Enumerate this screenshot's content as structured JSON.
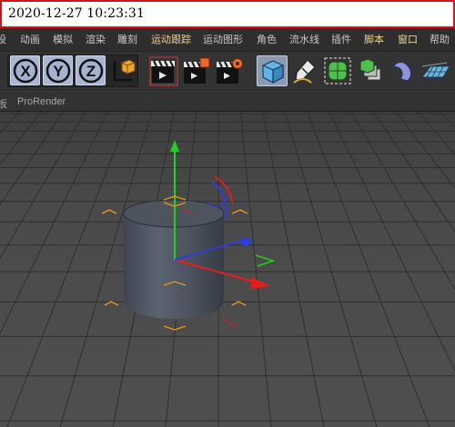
{
  "timestamp": "2020-12-27  10:23:31",
  "menu": {
    "items": [
      {
        "label": "设",
        "highlight": false
      },
      {
        "label": "动画",
        "highlight": false
      },
      {
        "label": "模拟",
        "highlight": false
      },
      {
        "label": "渲染",
        "highlight": false
      },
      {
        "label": "雕刻",
        "highlight": false
      },
      {
        "label": "运动跟踪",
        "highlight": true
      },
      {
        "label": "运动图形",
        "highlight": false
      },
      {
        "label": "角色",
        "highlight": false
      },
      {
        "label": "流水线",
        "highlight": false
      },
      {
        "label": "插件",
        "highlight": false
      },
      {
        "label": "脚本",
        "highlight": true
      },
      {
        "label": "窗口",
        "highlight": true
      },
      {
        "label": "帮助",
        "highlight": false
      }
    ]
  },
  "toolbar": {
    "x_axis": "X",
    "y_axis": "Y",
    "z_axis": "Z"
  },
  "tabs": {
    "partial": "板",
    "prorender": "ProRender"
  },
  "colors": {
    "highlight": "#f2d487",
    "timestamp_border": "#d4141b",
    "axis_y": "#1ed21e",
    "axis_x": "#e81c1c",
    "axis_z": "#2f3ce0",
    "gizmo_bracket": "#e89a1a"
  }
}
